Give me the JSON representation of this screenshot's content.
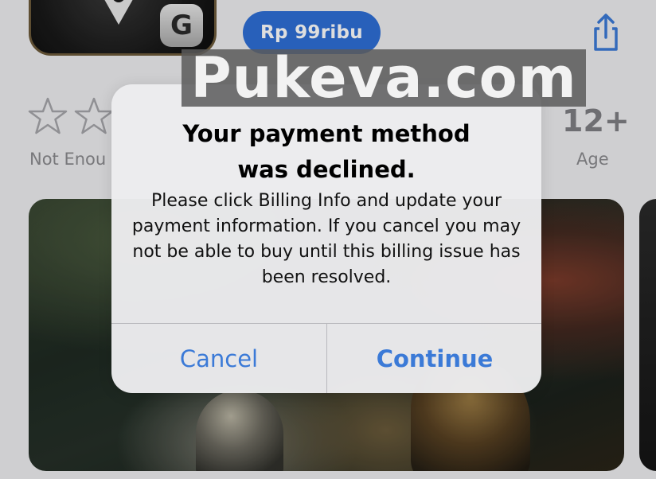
{
  "app": {
    "icon_name": "game-app-icon",
    "badge_letter": "G",
    "price_label": "Rp 99ribu"
  },
  "ratings": {
    "caption": "Not Enou",
    "stars_filled": 0
  },
  "age": {
    "value": "12+",
    "caption": "Age"
  },
  "watermark": {
    "text": "Pukeva.com"
  },
  "alert": {
    "title_line1": "Your payment method",
    "title_line2": "was declined.",
    "message": "Please click Billing Info and update your payment information. If you cancel you may not be able to buy until this billing issue has been resolved.",
    "cancel_label": "Cancel",
    "continue_label": "Continue"
  },
  "colors": {
    "accent": "#3b7ad7",
    "price_button": "#2f6fd6",
    "secondary_text": "#8a8a8e"
  },
  "icons": [
    "share-icon",
    "star-outline-icon"
  ]
}
